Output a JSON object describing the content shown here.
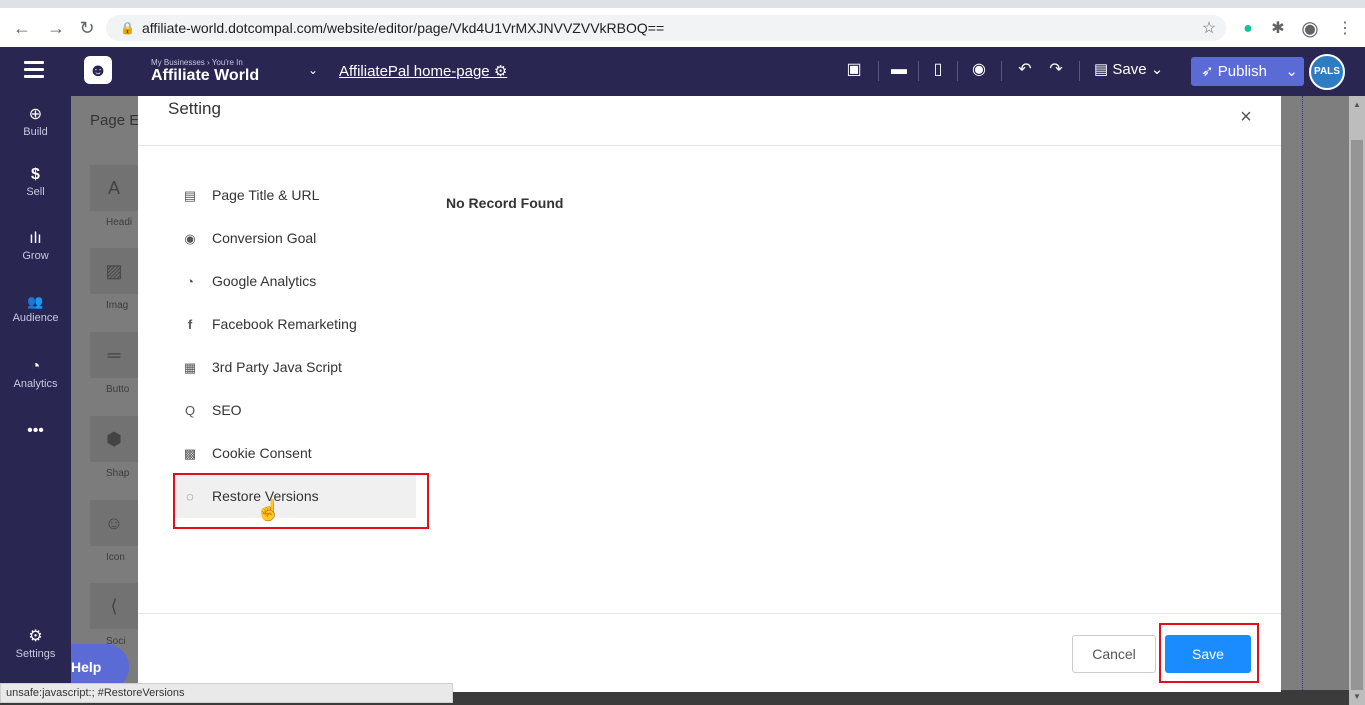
{
  "browser": {
    "url": "affiliate-world.dotcompal.com/website/editor/page/Vkd4U1VrMXJNVVZVVkRBOQ==",
    "back_icon": "←",
    "forward_icon": "→",
    "reload_icon": "↻",
    "lock_icon": "🔒",
    "star_icon": "☆",
    "grammarly_icon": "●",
    "extensions_icon": "✱",
    "profile_icon": "◉",
    "menu_icon": "⋮"
  },
  "header": {
    "crumb_small": "My Businesses › You're In",
    "business_name": "Affiliate World",
    "page_name": "AffiliatePal home-page",
    "gear_icon": "⚙",
    "save_label": "Save",
    "publish_label": "Publish",
    "avatar_text": "PALS",
    "tool_icons": [
      "▣",
      "▬",
      "▯",
      "◉",
      "↶",
      "↷"
    ],
    "save_icon": "▤",
    "chevron": "⌄",
    "publish_icon": "➶"
  },
  "rail": {
    "items": [
      {
        "icon": "⊕",
        "label": "Build"
      },
      {
        "icon": "$",
        "label": "Sell"
      },
      {
        "icon": "ılı",
        "label": "Grow"
      },
      {
        "icon": "👥",
        "label": "Audience"
      },
      {
        "icon": "◔",
        "label": "Analytics"
      },
      {
        "icon": "•••",
        "label": ""
      }
    ],
    "settings": {
      "icon": "⚙",
      "label": "Settings"
    },
    "help_label": "Help"
  },
  "panel": {
    "title": "Page E",
    "tiles": [
      {
        "icon": "A",
        "label": "Headi"
      },
      {
        "icon": "▨",
        "label": "Imag"
      },
      {
        "icon": "═",
        "label": "Butto"
      },
      {
        "icon": "⬢",
        "label": "Shap"
      },
      {
        "icon": "☺",
        "label": "Icon"
      },
      {
        "icon": "⟨",
        "label": "Soci"
      }
    ]
  },
  "modal": {
    "title": "Setting",
    "close_icon": "×",
    "menu": [
      {
        "icon": "▤",
        "label": "Page Title & URL"
      },
      {
        "icon": "◉",
        "label": "Conversion Goal"
      },
      {
        "icon": "◔",
        "label": "Google Analytics"
      },
      {
        "icon": "f",
        "label": "Facebook Remarketing"
      },
      {
        "icon": "▦",
        "label": "3rd Party Java Script"
      },
      {
        "icon": "Q",
        "label": "SEO"
      },
      {
        "icon": "▩",
        "label": "Cookie Consent"
      },
      {
        "icon": "◌",
        "label": "Restore Versions"
      }
    ],
    "no_record": "No Record Found",
    "cancel_label": "Cancel",
    "save_label": "Save"
  },
  "status_bar": "unsafe:javascript:; #RestoreVersions",
  "colors": {
    "header_bg": "#2a2652",
    "publish_bg": "#5b6bd6",
    "save_bg": "#1a8cff",
    "highlight": "#e0101a"
  }
}
